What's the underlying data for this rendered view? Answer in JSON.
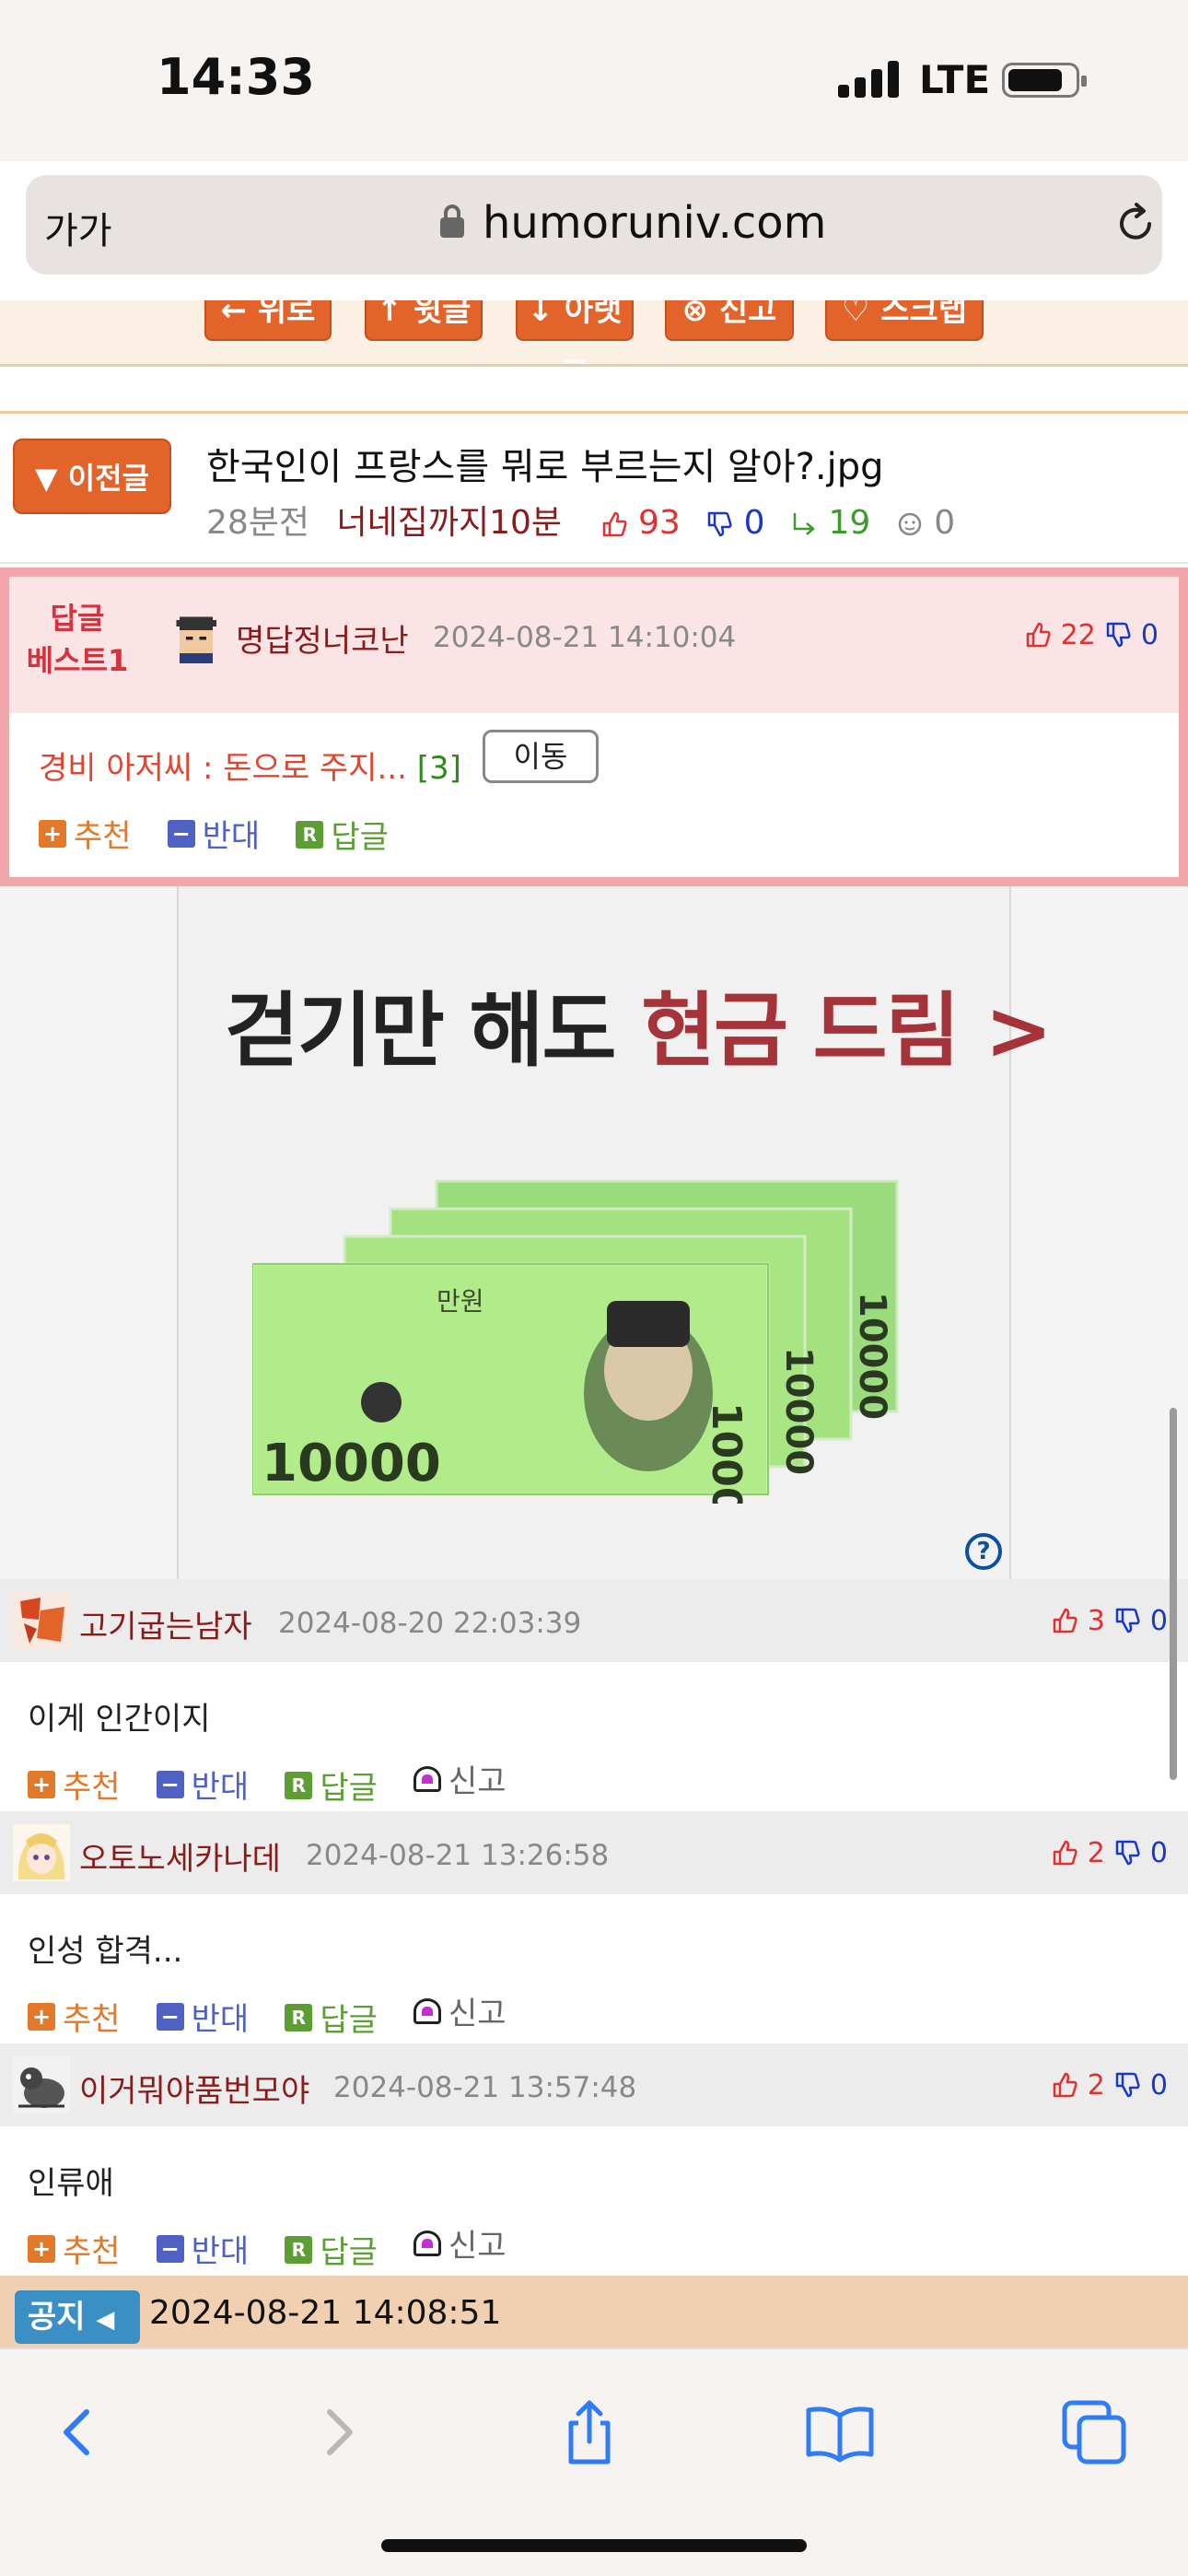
{
  "status_bar": {
    "time": "14:33",
    "network": "LTE"
  },
  "browser": {
    "text_size_label": "가가",
    "url": "humoruniv.com"
  },
  "post_buttons": [
    {
      "label": "← 위로"
    },
    {
      "label": "↑ 윗글"
    },
    {
      "label": "↓ 아랫글"
    },
    {
      "label": "⊗ 신고"
    },
    {
      "label": "♡ 스크랩"
    }
  ],
  "prev_post": {
    "button_label": "▼ 이전글",
    "title": "한국인이 프랑스를 뭐로 부르는지 알아?.jpg",
    "age": "28분전",
    "author": "너네집까지10분",
    "upvotes": "93",
    "downvotes": "0",
    "replies": "19",
    "views": "0"
  },
  "best_reply": {
    "badge_line1": "답글",
    "badge_line2": "베스트1",
    "nickname": "명답정너코난",
    "date": "2024-08-21 14:10:04",
    "upvotes": "22",
    "downvotes": "0",
    "text": "경비 아저씨 : 돈으로 주지...",
    "reply_count": "[3]",
    "move_label": "이동",
    "actions": {
      "recommend": "추천",
      "oppose": "반대",
      "reply": "답글"
    }
  },
  "ad": {
    "headline_black": "걷기만 해도 ",
    "headline_red": "현금 드림 >",
    "help": "?"
  },
  "comments": [
    {
      "nickname": "고기굽는남자",
      "date": "2024-08-20 22:03:39",
      "upvotes": "3",
      "downvotes": "0",
      "text": "이게 인간이지",
      "actions": {
        "recommend": "추천",
        "oppose": "반대",
        "reply": "답글",
        "report": "신고"
      }
    },
    {
      "nickname": "오토노세카나데",
      "date": "2024-08-21 13:26:58",
      "upvotes": "2",
      "downvotes": "0",
      "text": "인성 합격...",
      "actions": {
        "recommend": "추천",
        "oppose": "반대",
        "reply": "답글",
        "report": "신고"
      }
    },
    {
      "nickname": "이거뭐야품번모야",
      "date": "2024-08-21 13:57:48",
      "upvotes": "2",
      "downvotes": "0",
      "text": "인류애",
      "actions": {
        "recommend": "추천",
        "oppose": "반대",
        "reply": "답글",
        "report": "신고"
      }
    }
  ],
  "notice": {
    "badge": "공지",
    "date": "2024-08-21 14:08:51"
  },
  "colors": {
    "accent_orange": "#e2642a",
    "best_border": "#f3a7ab",
    "upvote_red": "#e23030",
    "downvote_blue": "#1a38c8",
    "nickname": "#8b1a1a",
    "ios_blue": "#2f7cf6"
  },
  "toolbar_icons": [
    "back-icon",
    "forward-icon",
    "share-icon",
    "bookmarks-icon",
    "tabs-icon"
  ]
}
